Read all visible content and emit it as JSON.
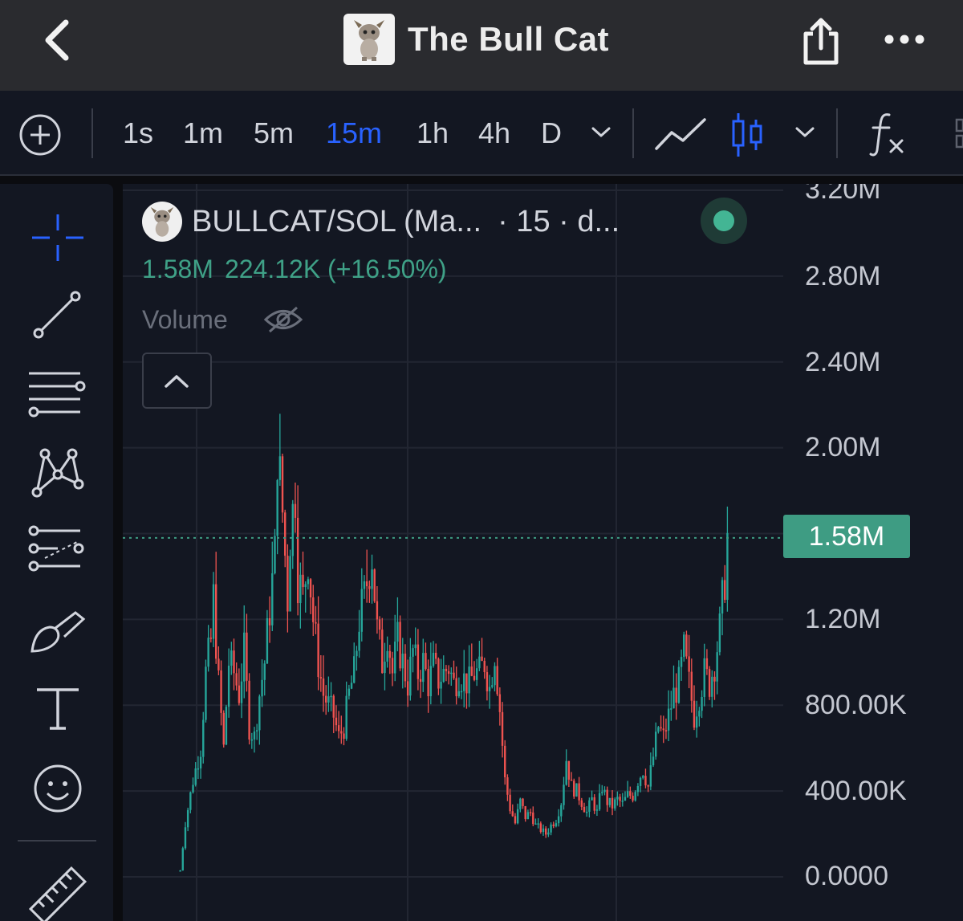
{
  "header": {
    "title": "The Bull Cat"
  },
  "toolbar": {
    "intervals": [
      "1s",
      "1m",
      "5m",
      "15m",
      "1h",
      "4h",
      "D"
    ],
    "active_interval": "15m"
  },
  "legend": {
    "symbol": "BULLCAT/SOL (Ma...",
    "interval_text": "· 15 · d...",
    "last_price": "1.58M",
    "change": "224.12K (+16.50%)",
    "volume_label": "Volume"
  },
  "price_axis": {
    "labels": [
      "3.20M",
      "2.80M",
      "2.40M",
      "2.00M",
      "1.20M",
      "800.00K",
      "400.00K",
      "0.0000"
    ],
    "current_price": "1.58M"
  },
  "colors": {
    "up": "#26a69a",
    "down": "#ef5350",
    "accent": "#2962ff",
    "price_tag": "#3e9c83"
  },
  "chart_data": {
    "type": "candlestick",
    "symbol": "BULLCAT/SOL",
    "interval": "15m",
    "ylim": [
      0,
      3200000
    ],
    "last": 1580000,
    "change": 224120,
    "change_pct": 16.5,
    "close_path": [
      [
        0,
        30000
      ],
      [
        2,
        250000
      ],
      [
        5,
        450000
      ],
      [
        8,
        600000
      ],
      [
        10,
        950000
      ],
      [
        12,
        1100000
      ],
      [
        13,
        1300000
      ],
      [
        15,
        900000
      ],
      [
        17,
        600000
      ],
      [
        19,
        1000000
      ],
      [
        21,
        950000
      ],
      [
        23,
        850000
      ],
      [
        25,
        1050000
      ],
      [
        27,
        700000
      ],
      [
        29,
        650000
      ],
      [
        31,
        850000
      ],
      [
        33,
        1000000
      ],
      [
        35,
        1250000
      ],
      [
        37,
        1500000
      ],
      [
        38,
        2000000
      ],
      [
        40,
        1700000
      ],
      [
        42,
        1300000
      ],
      [
        43,
        1600000
      ],
      [
        45,
        1800000
      ],
      [
        46,
        1400000
      ],
      [
        48,
        1300000
      ],
      [
        50,
        1500000
      ],
      [
        52,
        1200000
      ],
      [
        54,
        1000000
      ],
      [
        56,
        850000
      ],
      [
        58,
        800000
      ],
      [
        60,
        750000
      ],
      [
        62,
        650000
      ],
      [
        64,
        700000
      ],
      [
        66,
        850000
      ],
      [
        68,
        950000
      ],
      [
        70,
        1200000
      ],
      [
        72,
        1300000
      ],
      [
        74,
        1450000
      ],
      [
        75,
        1500000
      ],
      [
        77,
        1150000
      ],
      [
        79,
        1000000
      ],
      [
        81,
        1150000
      ],
      [
        83,
        950000
      ],
      [
        85,
        1100000
      ],
      [
        87,
        1000000
      ],
      [
        89,
        900000
      ],
      [
        91,
        1050000
      ],
      [
        93,
        950000
      ],
      [
        95,
        1000000
      ],
      [
        97,
        900000
      ],
      [
        99,
        980000
      ],
      [
        101,
        920000
      ],
      [
        103,
        950000
      ],
      [
        105,
        980000
      ],
      [
        107,
        900000
      ],
      [
        109,
        950000
      ],
      [
        111,
        920000
      ],
      [
        113,
        900000
      ],
      [
        115,
        950000
      ],
      [
        117,
        950000
      ],
      [
        119,
        1000000
      ],
      [
        121,
        880000
      ],
      [
        123,
        1050000
      ],
      [
        125,
        780000
      ],
      [
        127,
        450000
      ],
      [
        129,
        320000
      ],
      [
        131,
        250000
      ],
      [
        133,
        350000
      ],
      [
        135,
        280000
      ],
      [
        137,
        300000
      ],
      [
        139,
        240000
      ],
      [
        141,
        220000
      ],
      [
        143,
        200000
      ],
      [
        145,
        240000
      ],
      [
        147,
        270000
      ],
      [
        149,
        350000
      ],
      [
        151,
        550000
      ],
      [
        153,
        420000
      ],
      [
        155,
        400000
      ],
      [
        157,
        350000
      ],
      [
        159,
        300000
      ],
      [
        161,
        360000
      ],
      [
        163,
        300000
      ],
      [
        165,
        420000
      ],
      [
        167,
        350000
      ],
      [
        169,
        330000
      ],
      [
        171,
        360000
      ],
      [
        173,
        340000
      ],
      [
        175,
        380000
      ],
      [
        177,
        380000
      ],
      [
        179,
        450000
      ],
      [
        181,
        500000
      ],
      [
        183,
        420000
      ],
      [
        185,
        560000
      ],
      [
        187,
        700000
      ],
      [
        189,
        650000
      ],
      [
        191,
        750000
      ],
      [
        193,
        850000
      ],
      [
        195,
        900000
      ],
      [
        197,
        1050000
      ],
      [
        199,
        900000
      ],
      [
        201,
        750000
      ],
      [
        203,
        850000
      ],
      [
        205,
        950000
      ],
      [
        207,
        900000
      ],
      [
        209,
        1000000
      ],
      [
        211,
        1150000
      ],
      [
        213,
        1400000
      ],
      [
        214,
        1580000
      ]
    ]
  }
}
